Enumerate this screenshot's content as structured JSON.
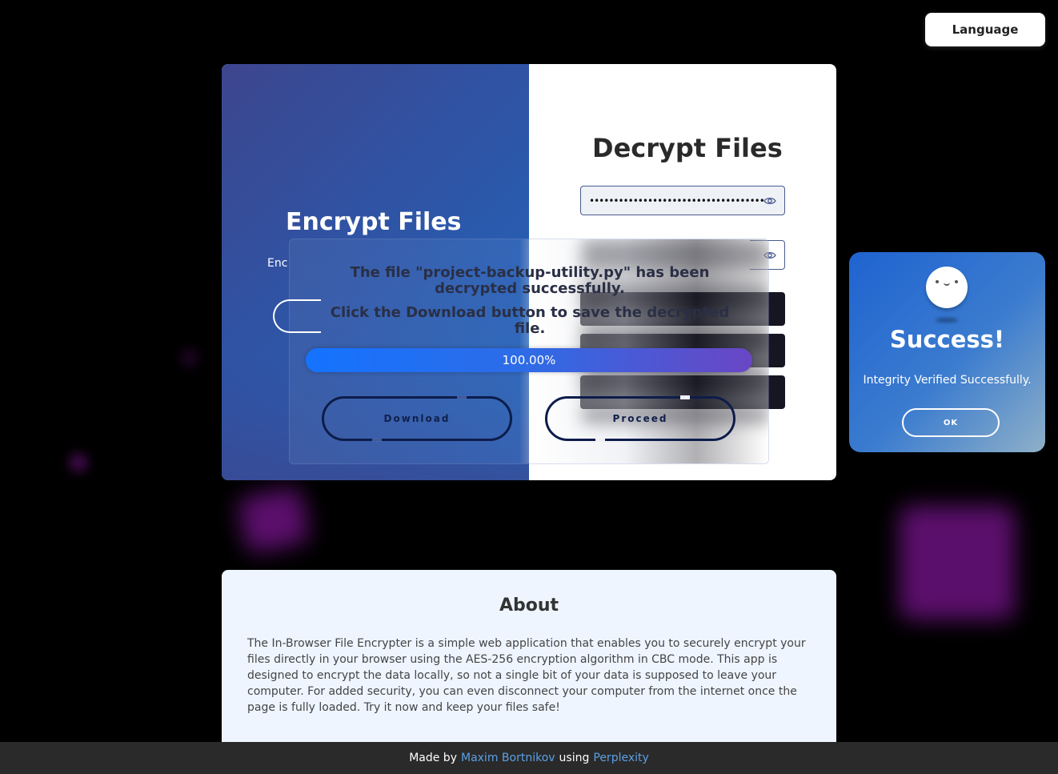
{
  "header": {
    "language_label": "Language"
  },
  "encrypt": {
    "title": "Encrypt Files",
    "subtitle": "Enc"
  },
  "decrypt": {
    "title": "Decrypt Files",
    "password_value": "••••••••••••••••••••••••••••••••••••••••••••"
  },
  "overlay": {
    "message1": "The file \"project-backup-utility.py\" has been decrypted successfully.",
    "message2": "Click the Download button to save the decrypted file.",
    "progress": 1.0,
    "progress_text": "100.00%",
    "download_label": "Download",
    "proceed_label": "Proceed"
  },
  "success": {
    "title": "Success!",
    "message": "Integrity Verified Successfully.",
    "ok_label": "OK"
  },
  "about": {
    "title": "About",
    "text": "The In-Browser File Encrypter is a simple web application that enables you to securely encrypt your files directly in your browser using the AES-256 encryption algorithm in CBC mode. This app is designed to encrypt the data locally, so not a single bit of your data is supposed to leave your computer. For added security, you can even disconnect your computer from the internet once the page is fully loaded. Try it now and keep your files safe!"
  },
  "footer": {
    "made_by": "Made by",
    "author": "Maxim Bortnikov",
    "using": "using",
    "tool": "Perplexity"
  },
  "icons": {
    "eye": "eye-icon",
    "face": "smiley-face-icon"
  }
}
